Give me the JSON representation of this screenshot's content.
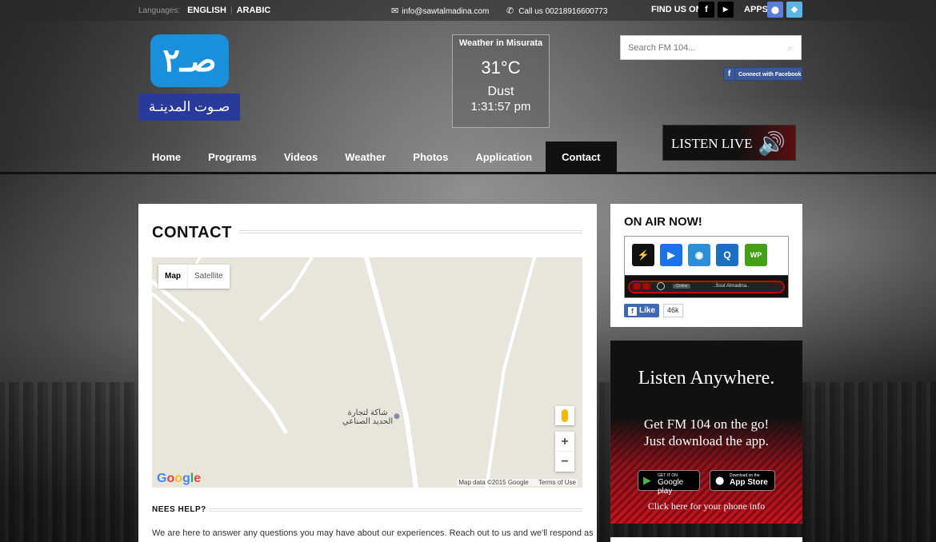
{
  "topbar": {
    "languages_label": "Languages:",
    "lang_english": "ENGLISH",
    "lang_sep": "|",
    "lang_arabic": "ARABIC",
    "email": "info@sawtalmadina.com",
    "phone": "Call us 00218916600773",
    "find_us": "FIND US ON",
    "apps": "APPS"
  },
  "logo": {
    "mark": "صـ٢",
    "text": "صـوت المدينـة"
  },
  "weather": {
    "title": "Weather in Misurata",
    "temp": "31°C",
    "condition": "Dust",
    "time": "1:31:57 pm"
  },
  "search": {
    "placeholder": "Search FM 104..."
  },
  "facebook_connect": "Connect with Facebook",
  "listen_live": "LISTEN LIVE",
  "nav": [
    "Home",
    "Programs",
    "Videos",
    "Weather",
    "Photos",
    "Application",
    "Contact"
  ],
  "main": {
    "title": "CONTACT",
    "map": {
      "map_btn": "Map",
      "satellite_btn": "Satellite",
      "label": "شاكة لتجارة\nالحديد الصناعي",
      "data": "Map data ©2015 Google",
      "terms": "Terms of Use",
      "google": "Google"
    },
    "help_title": "NEES HELP?",
    "help_text": "We are here to answer any questions you may have about our experiences. Reach out to us and we'll respond as"
  },
  "sidebar": {
    "on_air": "ON AIR NOW!",
    "player_text": "..Sout Almadina..",
    "player_label": "Online",
    "like": "Like",
    "like_count": "46k"
  },
  "promo": {
    "title": "Listen Anywhere.",
    "line1": "Get FM 104 on the go!",
    "line2": "Just download the app.",
    "gp_small": "GET IT ON",
    "gp_big": "Google play",
    "as_small": "Download on the",
    "as_big": "App Store",
    "link": "Click here for your phone info"
  },
  "colors": {
    "facebook": "#3b5998",
    "accent_red": "#c4141f",
    "logo_blue": "#1a8fdc",
    "logo_navy": "#2a3a9a"
  }
}
